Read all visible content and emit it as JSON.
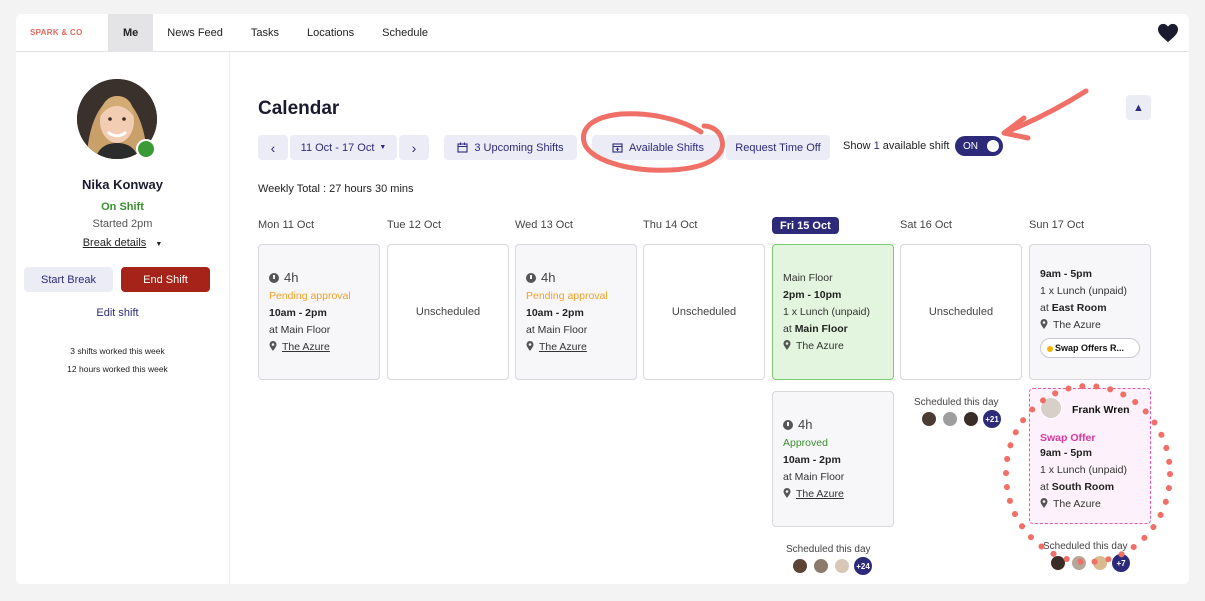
{
  "brand": "SPARK & CO",
  "nav": [
    {
      "label": "Me"
    },
    {
      "label": "News Feed"
    },
    {
      "label": "Tasks"
    },
    {
      "label": "Locations"
    },
    {
      "label": "Schedule"
    }
  ],
  "sidebar": {
    "name": "Nika Konway",
    "status": "On Shift",
    "started": "Started 2pm",
    "break_details": "Break details",
    "start_break": "Start Break",
    "end_shift": "End Shift",
    "edit_shift": "Edit shift",
    "stat_shifts": "3 shifts worked this week",
    "stat_hours": "12 hours worked this week"
  },
  "calendar": {
    "title": "Calendar",
    "date_range": "11 Oct - 17 Oct",
    "upcoming": "3 Upcoming Shifts",
    "available": "Available Shifts",
    "request_off": "Request Time Off",
    "show_prefix": "Show",
    "show_count": "1",
    "show_suffix": "available shift",
    "toggle": "ON",
    "weekly_total": "Weekly Total : 27 hours 30 mins",
    "days": [
      "Mon 11 Oct",
      "Tue 12 Oct",
      "Wed 13 Oct",
      "Thu 14 Oct",
      "Fri 15 Oct",
      "Sat 16 Oct",
      "Sun 17 Oct"
    ],
    "mon": {
      "hours": "4h",
      "status": "Pending approval",
      "time": "10am - 2pm",
      "at": "at Main Floor",
      "loc": "The Azure"
    },
    "tue": {
      "text": "Unscheduled"
    },
    "wed": {
      "hours": "4h",
      "status": "Pending approval",
      "time": "10am - 2pm",
      "at": "at Main Floor",
      "loc": "The Azure"
    },
    "thu": {
      "text": "Unscheduled"
    },
    "fri": {
      "area": "Main Floor",
      "time": "2pm - 10pm",
      "lunch": "1 x Lunch (unpaid)",
      "at_prefix": "at",
      "at": "Main Floor",
      "loc": "The Azure"
    },
    "fri2": {
      "hours": "4h",
      "status": "Approved",
      "time": "10am - 2pm",
      "at": "at Main Floor",
      "loc": "The Azure"
    },
    "fri_sched": {
      "label": "Scheduled this day",
      "more": "+24"
    },
    "sat": {
      "text": "Unscheduled"
    },
    "sat_sched": {
      "label": "Scheduled this day",
      "more": "+21"
    },
    "sun": {
      "time": "9am - 5pm",
      "lunch": "1 x Lunch (unpaid)",
      "at_prefix": "at",
      "at": "East Room",
      "loc": "The Azure",
      "badge": "Swap Offers R..."
    },
    "sun_swap": {
      "name": "Frank Wren",
      "label": "Swap Offer",
      "time": "9am - 5pm",
      "lunch": "1 x Lunch (unpaid)",
      "at_prefix": "at",
      "at": "South Room",
      "loc": "The Azure"
    },
    "sun_sched": {
      "label": "Scheduled this day",
      "more": "+7"
    }
  },
  "colors": {
    "accent": "#2e2a7a",
    "danger": "#a52318",
    "success": "#3b8f2f",
    "pending": "#f0a02a",
    "annotation": "#f07067",
    "swap": "#d9379a"
  }
}
